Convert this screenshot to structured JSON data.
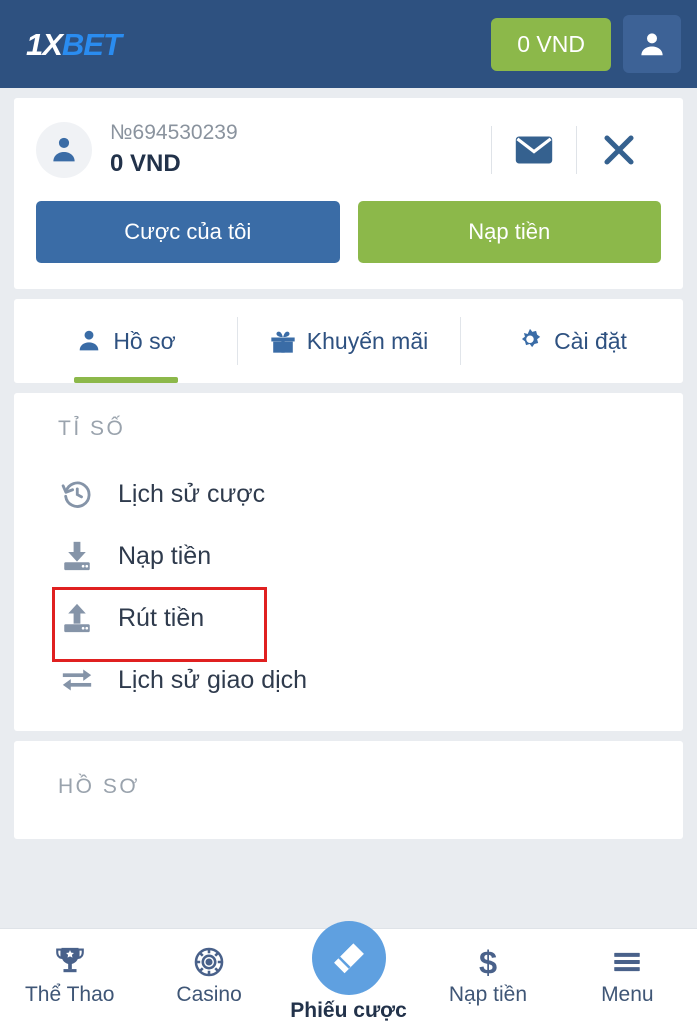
{
  "header": {
    "logo_1x": "1X",
    "logo_bet": "BET",
    "balance_label": "0 VND",
    "user_icon": "user-icon",
    "bg_color": "#2e5180",
    "accent_green": "#8cb84a"
  },
  "account": {
    "avatar_icon": "user-avatar-icon",
    "account_number": "№694530239",
    "balance": "0 VND",
    "mail_icon": "envelope-icon",
    "close_icon": "close-icon",
    "buttons": {
      "my_bets": "Cược của tôi",
      "deposit": "Nạp tiền"
    }
  },
  "tabs": [
    {
      "label": "Hồ sơ",
      "icon": "user-icon",
      "active": true
    },
    {
      "label": "Khuyến mãi",
      "icon": "gift-icon",
      "active": false
    },
    {
      "label": "Cài đặt",
      "icon": "gear-icon",
      "active": false
    }
  ],
  "menu": {
    "section_label": "TỈ SỐ",
    "items": [
      {
        "label": "Lịch sử cược",
        "icon": "history-icon",
        "highlighted": false
      },
      {
        "label": "Nạp tiền",
        "icon": "download-icon",
        "highlighted": false
      },
      {
        "label": "Rút tiền",
        "icon": "upload-icon",
        "highlighted": true
      },
      {
        "label": "Lịch sử giao dịch",
        "icon": "exchange-icon",
        "highlighted": false
      }
    ],
    "highlight_color": "#e02020"
  },
  "profile_section": {
    "section_label": "HỒ SƠ"
  },
  "bottom_nav": [
    {
      "label": "Thể Thao",
      "icon": "trophy-icon",
      "active": false
    },
    {
      "label": "Casino",
      "icon": "casino-chip-icon",
      "active": false
    },
    {
      "label": "Phiếu cược",
      "icon": "betslip-ticket-icon",
      "active": true
    },
    {
      "label": "Nạp tiền",
      "icon": "dollar-icon",
      "active": false
    },
    {
      "label": "Menu",
      "icon": "hamburger-icon",
      "active": false
    }
  ]
}
